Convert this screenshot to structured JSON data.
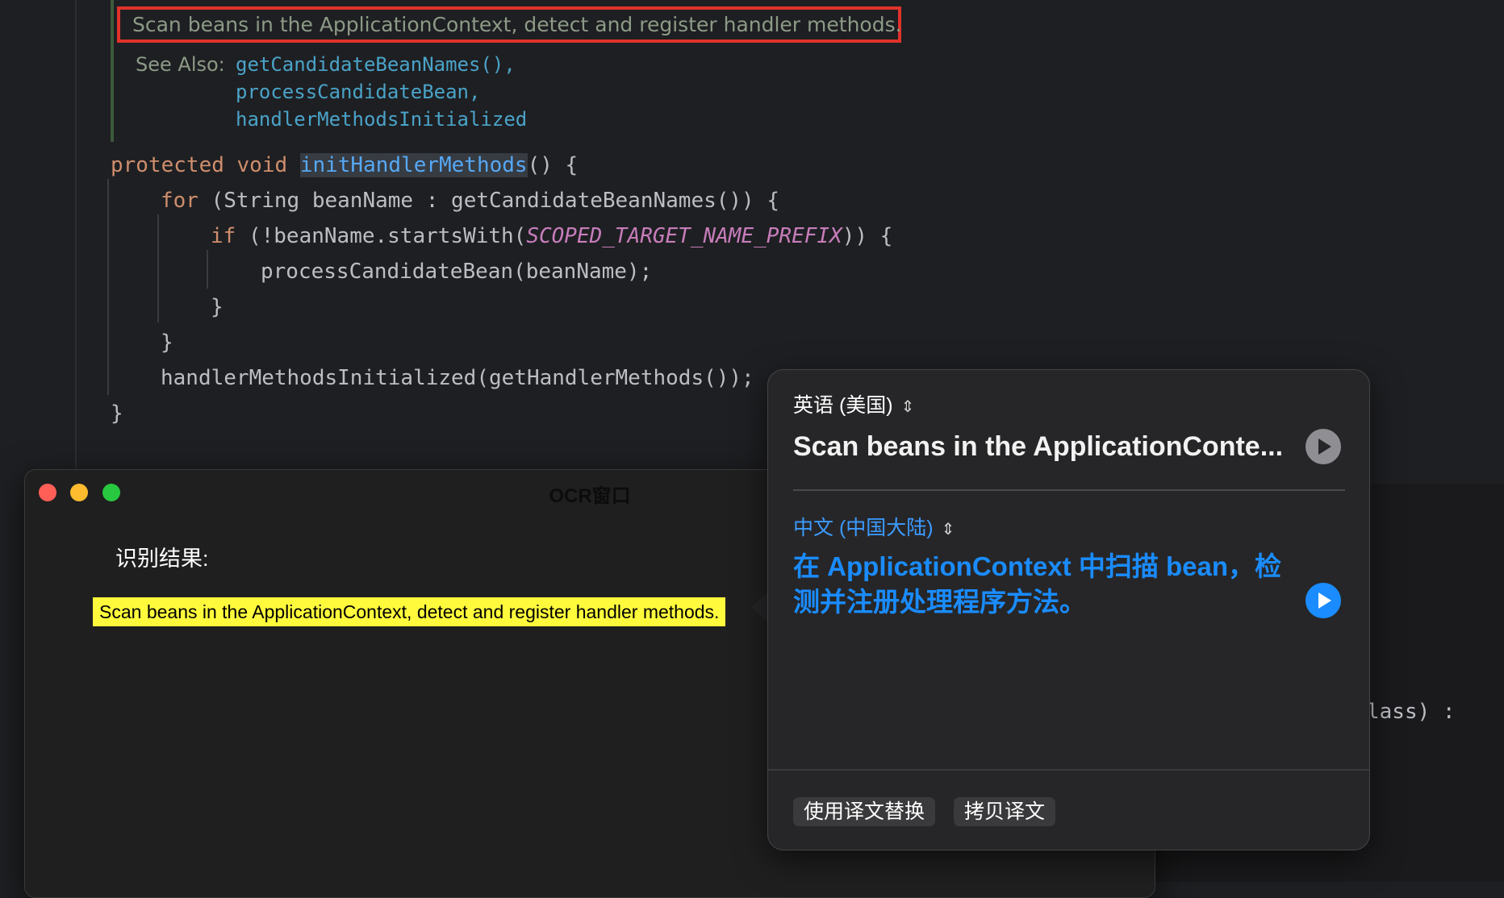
{
  "editor": {
    "doc_comment": "Scan beans in the ApplicationContext, detect and register handler methods.",
    "see_also_label": "See Also:",
    "see_also_links": [
      "getCandidateBeanNames(),",
      "processCandidateBean,",
      "handlerMethodsInitialized"
    ],
    "code": {
      "l1_kw": "protected void ",
      "l1_fn": "initHandlerMethods",
      "l1_rest": "() {",
      "l2_kw": "for",
      "l2_rest": " (String beanName : getCandidateBeanNames()) {",
      "l3_kw": "if",
      "l3_a": " (!beanName.startsWith(",
      "l3_const": "SCOPED_TARGET_NAME_PREFIX",
      "l3_b": ")) {",
      "l4": "processCandidateBean(beanName);",
      "l5": "}",
      "l6": "}",
      "l7": "handlerMethodsInitialized(getHandlerMethods());",
      "l8": "}"
    },
    "bg_fragment": "lass) :"
  },
  "ocr_window": {
    "title": "OCR窗口",
    "result_label": "识别结果:",
    "result_text": "Scan beans in the ApplicationContext, detect and register handler methods."
  },
  "translate": {
    "source_lang": "英语 (美国)",
    "source_text": "Scan beans in the ApplicationConte...",
    "target_lang": "中文 (中国大陆)",
    "target_text": "在 ApplicationContext 中扫描 bean，检测并注册处理程序方法。",
    "replace_label": "使用译文替换",
    "copy_label": "拷贝译文"
  },
  "colors": {
    "highlight_border": "#e0332b",
    "ocr_highlight": "#fffb3c",
    "accent_blue": "#1a8cff"
  }
}
